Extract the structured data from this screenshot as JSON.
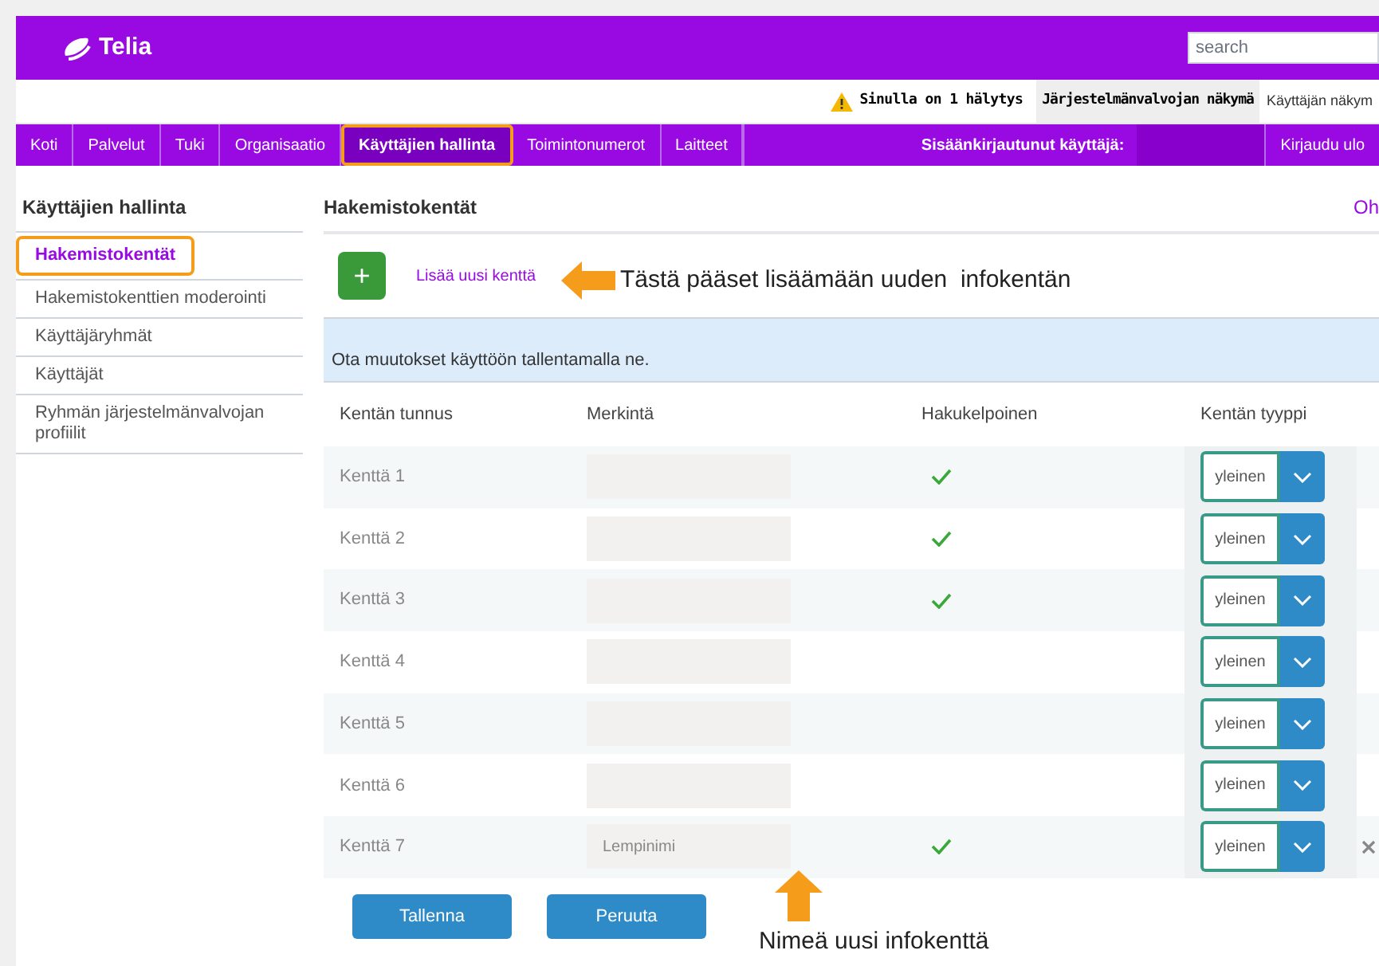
{
  "header": {
    "logo": "Telia",
    "search": {
      "placeholder": "search"
    }
  },
  "topbar": {
    "alert": "Sinulla on 1 hälytys",
    "views": [
      {
        "label": "Järjestelmänvalvojan näkymä",
        "selected": true
      },
      {
        "label": "Käyttäjän näkym",
        "selected": false
      }
    ]
  },
  "nav": {
    "items": [
      {
        "label": "Koti",
        "selected": false
      },
      {
        "label": "Palvelut",
        "selected": false
      },
      {
        "label": "Tuki",
        "selected": false
      },
      {
        "label": "Organisaatio",
        "selected": false
      },
      {
        "label": "Käyttäjien hallinta",
        "selected": true
      },
      {
        "label": "Toimintonumerot",
        "selected": false
      },
      {
        "label": "Laitteet",
        "selected": false
      }
    ],
    "logged_in": "Sisäänkirjautunut käyttäjä:",
    "logout": "Kirjaudu ulo"
  },
  "sidebar": {
    "title": "Käyttäjien hallinta",
    "items": [
      {
        "label": "Hakemistokentät",
        "selected": true
      },
      {
        "label": "Hakemistokenttien moderointi",
        "selected": false
      },
      {
        "label": "Käyttäjäryhmät",
        "selected": false
      },
      {
        "label": "Käyttäjät",
        "selected": false
      },
      {
        "label": "Ryhmän järjestelmänvalvojan profiilit",
        "selected": false
      }
    ]
  },
  "main": {
    "title": "Hakemistokentät",
    "help": "Oh",
    "add_button": "+",
    "add_link": "Lisää uusi kenttä",
    "notice": "Ota muutokset käyttöön tallentamalla ne.",
    "table": {
      "columns": [
        "Kentän tunnus",
        "Merkintä",
        "Hakukelpoinen",
        "Kentän tyyppi"
      ],
      "rows": [
        {
          "id": "Kenttä 1",
          "label": "",
          "searchable": true,
          "type": "yleinen",
          "removable": false
        },
        {
          "id": "Kenttä 2",
          "label": "",
          "searchable": true,
          "type": "yleinen",
          "removable": false
        },
        {
          "id": "Kenttä 3",
          "label": "",
          "searchable": true,
          "type": "yleinen",
          "removable": false
        },
        {
          "id": "Kenttä 4",
          "label": "",
          "searchable": false,
          "type": "yleinen",
          "removable": false
        },
        {
          "id": "Kenttä 5",
          "label": "",
          "searchable": false,
          "type": "yleinen",
          "removable": false
        },
        {
          "id": "Kenttä 6",
          "label": "",
          "searchable": false,
          "type": "yleinen",
          "removable": false
        },
        {
          "id": "Kenttä 7",
          "label": "Lempinimi",
          "searchable": true,
          "type": "yleinen",
          "removable": true
        }
      ]
    },
    "buttons": [
      "Tallenna",
      "Peruuta"
    ]
  },
  "annotations": [
    {
      "kind": "left",
      "text": "Tästä pääset lisäämään uuden  infokentän"
    },
    {
      "kind": "up",
      "text": "Nimeä uusi infokenttä"
    }
  ]
}
